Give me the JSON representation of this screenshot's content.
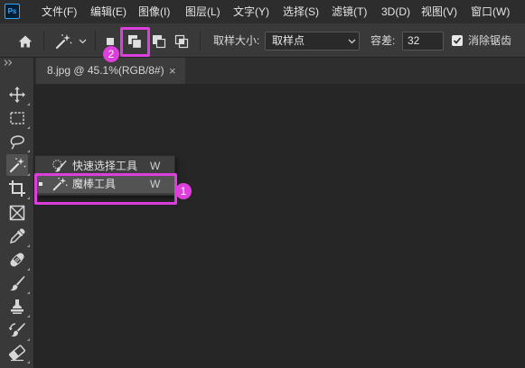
{
  "app": {
    "logo_text": "Ps"
  },
  "menu": {
    "items": [
      "文件(F)",
      "编辑(E)",
      "图像(I)",
      "图层(L)",
      "文字(Y)",
      "选择(S)",
      "滤镜(T)",
      "3D(D)",
      "视图(V)",
      "窗口(W)"
    ]
  },
  "options_bar": {
    "home_icon": "home-icon",
    "tool_preset": {
      "icon": "magic-wand-icon",
      "dropdown_icon": "chevron-down-icon"
    },
    "selection_modes": [
      {
        "icon": "new-selection-icon"
      },
      {
        "icon": "add-to-selection-icon"
      },
      {
        "icon": "subtract-from-selection-icon"
      },
      {
        "icon": "intersect-with-selection-icon"
      }
    ],
    "sample_size": {
      "label": "取样大小:",
      "value": "取样点",
      "dropdown_icon": "chevron-down-icon"
    },
    "tolerance": {
      "label": "容差:",
      "value": "32"
    },
    "anti_alias": {
      "label": "消除锯齿",
      "checked": true
    }
  },
  "document": {
    "tab_title": "8.jpg @ 45.1%(RGB/8#)",
    "close_glyph": "×"
  },
  "toolbar": {
    "collapse_icon": "double-chevron-icon",
    "tools": [
      "move-icon",
      "rectangular-marquee-icon",
      "lasso-icon",
      "magic-wand-icon",
      "crop-icon",
      "frame-icon",
      "eyedropper-icon",
      "spot-healing-brush-icon",
      "brush-icon",
      "clone-stamp-icon",
      "history-brush-icon",
      "eraser-icon"
    ],
    "active_tool": "magic-wand-icon"
  },
  "tool_flyout": {
    "items": [
      {
        "icon": "quick-selection-icon",
        "label": "快速选择工具",
        "shortcut": "W",
        "current": false
      },
      {
        "icon": "magic-wand-icon",
        "label": "魔棒工具",
        "shortcut": "W",
        "current": true
      }
    ]
  },
  "annotations": {
    "flyout_marker": "1",
    "option_marker": "2"
  },
  "colors": {
    "annotation": "#dd3fdd",
    "logo": "#31a8ff"
  }
}
